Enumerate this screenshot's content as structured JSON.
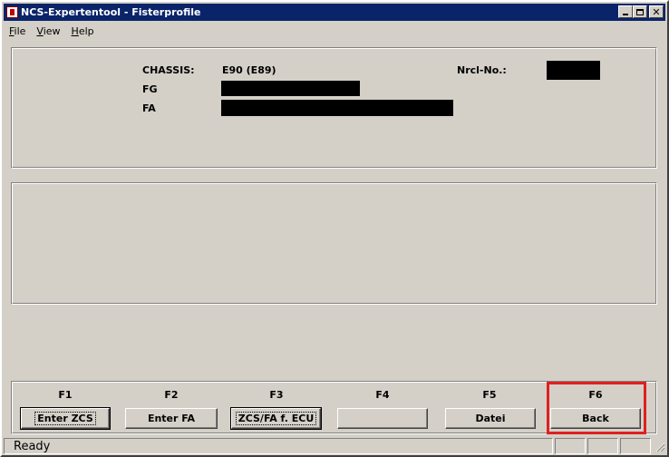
{
  "window": {
    "title": "NCS-Expertentool - Fisterprofile"
  },
  "menu": {
    "file": {
      "underline": "F",
      "rest": "ile"
    },
    "view": {
      "underline": "V",
      "rest": "iew"
    },
    "help": {
      "underline": "H",
      "rest": "elp"
    }
  },
  "vehicle": {
    "chassis_label": "CHASSIS:",
    "chassis_value": "E90 (E89)",
    "fg_label": "FG",
    "fa_label": "FA",
    "nrcl_label": "Nrcl-No.:"
  },
  "function_keys": {
    "f1": {
      "key": "F1",
      "label": "Enter ZCS"
    },
    "f2": {
      "key": "F2",
      "label": "Enter FA"
    },
    "f3": {
      "key": "F3",
      "label": "ZCS/FA f. ECU"
    },
    "f4": {
      "key": "F4",
      "label": ""
    },
    "f5": {
      "key": "F5",
      "label": "Datei"
    },
    "f6": {
      "key": "F6",
      "label": "Back"
    }
  },
  "status": {
    "text": "Ready"
  },
  "colors": {
    "titlebar": "#0a246a",
    "face": "#d4d0c8",
    "highlight": "#e02020"
  }
}
